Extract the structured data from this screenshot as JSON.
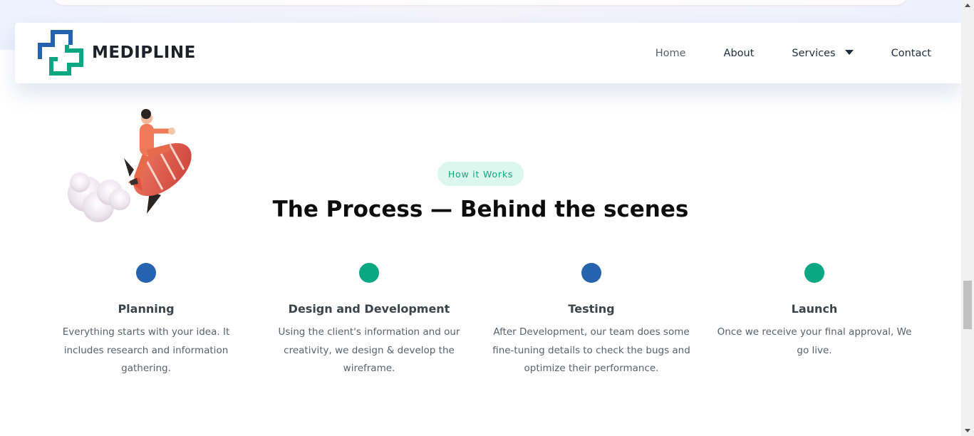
{
  "brand": {
    "name": "MEDIPLINE",
    "primary_color": "#2563ae",
    "accent_color": "#0aa882"
  },
  "nav": {
    "items": [
      "Home",
      "About",
      "Services",
      "Contact"
    ],
    "services_icon": "caret-down-icon"
  },
  "section": {
    "badge": "How it Works",
    "title": "The Process — Behind the scenes",
    "illustration": "rocket-rider-illustration"
  },
  "steps": [
    {
      "title": "Planning",
      "description": "Everything starts with your idea. It includes research and information gathering.",
      "dot_color": "#2563ae"
    },
    {
      "title": "Design and Development",
      "description": "Using the client's information and our creativity, we design & develop the wireframe.",
      "dot_color": "#0aa882"
    },
    {
      "title": "Testing",
      "description": "After Development, our team does some fine-tuning details to check the bugs and optimize their performance.",
      "dot_color": "#2563ae"
    },
    {
      "title": "Launch",
      "description": "Once we receive your final approval, We go live.",
      "dot_color": "#0aa882"
    }
  ]
}
